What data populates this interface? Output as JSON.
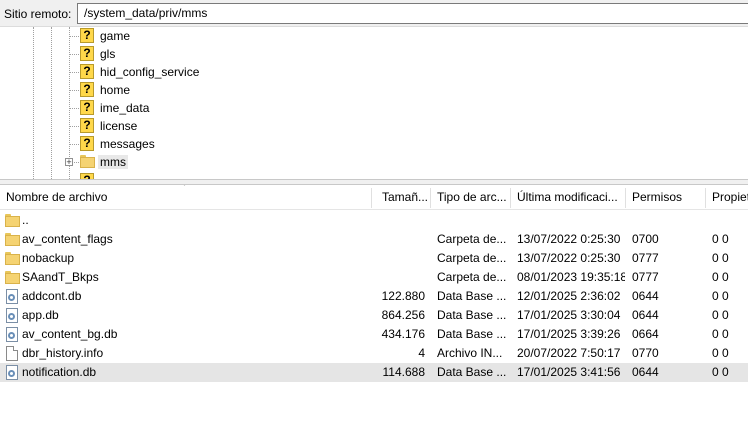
{
  "remote": {
    "label": "Sitio remoto:",
    "path": "/system_data/priv/mms"
  },
  "tree": {
    "items": [
      {
        "label": "game"
      },
      {
        "label": "gls"
      },
      {
        "label": "hid_config_service"
      },
      {
        "label": "home"
      },
      {
        "label": "ime_data"
      },
      {
        "label": "license"
      },
      {
        "label": "messages"
      },
      {
        "label": "mms"
      }
    ]
  },
  "columns": {
    "name": "Nombre de archivo",
    "size": "Tamañ...",
    "type": "Tipo de arc...",
    "modified": "Última modificaci...",
    "perms": "Permisos",
    "owner": "Propiet"
  },
  "files": [
    {
      "name": "..",
      "size": "",
      "type": "",
      "modified": "",
      "perms": "",
      "owner": "",
      "icon": "folder-icon"
    },
    {
      "name": "av_content_flags",
      "size": "",
      "type": "Carpeta de...",
      "modified": "13/07/2022 0:25:30",
      "perms": "0700",
      "owner": "0 0",
      "icon": "folder-icon"
    },
    {
      "name": "nobackup",
      "size": "",
      "type": "Carpeta de...",
      "modified": "13/07/2022 0:25:30",
      "perms": "0777",
      "owner": "0 0",
      "icon": "folder-icon"
    },
    {
      "name": "SAandT_Bkps",
      "size": "",
      "type": "Carpeta de...",
      "modified": "08/01/2023 19:35:18",
      "perms": "0777",
      "owner": "0 0",
      "icon": "folder-icon"
    },
    {
      "name": "addcont.db",
      "size": "122.880",
      "type": "Data Base ...",
      "modified": "12/01/2025 2:36:02",
      "perms": "0644",
      "owner": "0 0",
      "icon": "database-file-icon"
    },
    {
      "name": "app.db",
      "size": "864.256",
      "type": "Data Base ...",
      "modified": "17/01/2025 3:30:04",
      "perms": "0644",
      "owner": "0 0",
      "icon": "database-file-icon"
    },
    {
      "name": "av_content_bg.db",
      "size": "434.176",
      "type": "Data Base ...",
      "modified": "17/01/2025 3:39:26",
      "perms": "0664",
      "owner": "0 0",
      "icon": "database-file-icon"
    },
    {
      "name": "dbr_history.info",
      "size": "4",
      "type": "Archivo IN...",
      "modified": "20/07/2022 7:50:17",
      "perms": "0770",
      "owner": "0 0",
      "icon": "document-file-icon"
    },
    {
      "name": "notification.db",
      "size": "114.688",
      "type": "Data Base ...",
      "modified": "17/01/2025 3:41:56",
      "perms": "0644",
      "owner": "0 0",
      "icon": "database-file-icon",
      "selected": true
    }
  ],
  "colors": {
    "folder": "#f5d372",
    "unknown_icon": "#ffd84a",
    "selected_row": "#e5e5e5"
  }
}
